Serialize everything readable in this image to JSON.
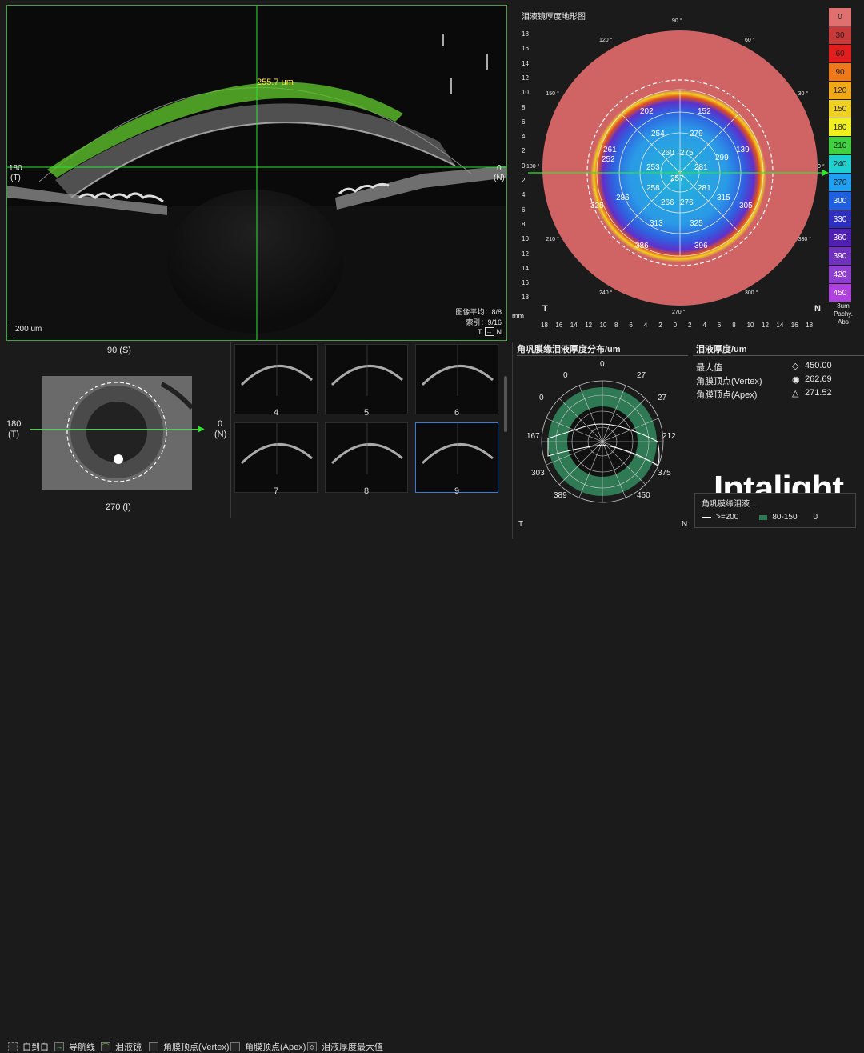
{
  "oct": {
    "thickness_label": "255.7 um",
    "left_label_deg": "180",
    "left_label_dir": "(T)",
    "right_label_deg": "0",
    "right_label_dir": "(N)",
    "scale_bar": "200 um",
    "avg_label": "图像平均：8/8",
    "index_label": "索引：9/16",
    "dir_from": "T",
    "dir_to": "N"
  },
  "topo": {
    "title": "泪液镜厚度地形图",
    "unit": "mm",
    "dir_left": "T",
    "dir_right": "N",
    "y_ticks": [
      "18",
      "16",
      "14",
      "12",
      "10",
      "8",
      "6",
      "4",
      "2",
      "0",
      "2",
      "4",
      "6",
      "8",
      "10",
      "12",
      "14",
      "16",
      "18"
    ],
    "x_ticks": [
      "18",
      "16",
      "14",
      "12",
      "10",
      "8",
      "6",
      "4",
      "2",
      "0",
      "2",
      "4",
      "6",
      "8",
      "10",
      "12",
      "14",
      "16",
      "18"
    ],
    "angles": [
      "90 °",
      "60 °",
      "30 °",
      "0 °",
      "330 °",
      "300 °",
      "270 °",
      "240 °",
      "210 °",
      "180 °",
      "150 °",
      "120 °"
    ],
    "sector_values": [
      "202",
      "152",
      "254",
      "279",
      "261",
      "260",
      "275",
      "299",
      "139",
      "252",
      "253",
      "281",
      "257",
      "258",
      "281",
      "286",
      "266",
      "276",
      "315",
      "325",
      "305",
      "313",
      "325",
      "386",
      "396"
    ],
    "scale_values": [
      "0",
      "30",
      "60",
      "90",
      "120",
      "150",
      "180",
      "210",
      "240",
      "270",
      "300",
      "330",
      "360",
      "390",
      "420",
      "450"
    ],
    "scale_colors": [
      "#e07070",
      "#c83a3a",
      "#e01e1e",
      "#f07818",
      "#f0a818",
      "#f0d020",
      "#f0f020",
      "#40d040",
      "#20d0d0",
      "#20a0f0",
      "#2060e0",
      "#3030c0",
      "#5020b0",
      "#7030c0",
      "#9040d0",
      "#b040e0"
    ],
    "scale_caption_1": "8um",
    "scale_caption_2": "Pachy.",
    "scale_caption_3": "Abs"
  },
  "iris": {
    "top_label": "90 (S)",
    "bottom_label": "270 (I)",
    "left_deg": "180",
    "left_dir": "(T)",
    "right_deg": "0",
    "right_dir": "(N)"
  },
  "thumbs": {
    "labels": [
      "4",
      "5",
      "6",
      "7",
      "8",
      "9"
    ]
  },
  "polar": {
    "title": "角巩膜缘泪液厚度分布/um",
    "labels": [
      "0",
      "0",
      "27",
      "0",
      "27",
      "167",
      "212",
      "303",
      "375",
      "389",
      "450"
    ],
    "dir_left": "T",
    "dir_right": "N"
  },
  "stats": {
    "title": "泪液厚度/um",
    "rows": [
      {
        "label": "最大值",
        "value": "450.00"
      },
      {
        "label": "角膜顶点(Vertex)",
        "value": "262.69"
      },
      {
        "label": "角膜顶点(Apex)",
        "value": "271.52"
      }
    ]
  },
  "brand": "Intalight",
  "legend_box": {
    "row1": "角巩膜缘泪液...",
    "row2_a": ">=200",
    "row2_b": "80-150",
    "row2_c": "0"
  },
  "toolbar": {
    "items": [
      "白到白",
      "导航线",
      "泪液镜",
      "角膜顶点(Vertex)",
      "角膜顶点(Apex)",
      "泪液厚度最大值"
    ]
  }
}
